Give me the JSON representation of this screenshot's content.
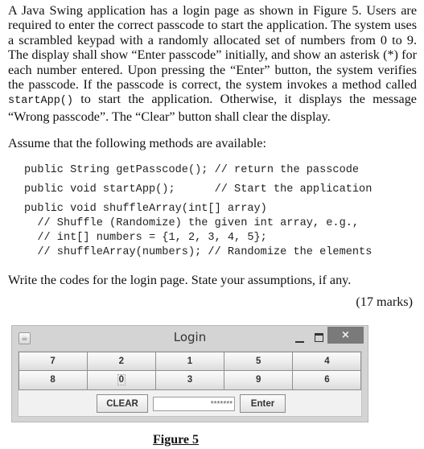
{
  "question": {
    "paragraph_parts": {
      "before_code": "A Java Swing application has a login page as shown in Figure 5.  Users are required to enter the correct passcode to start the application.  The system uses a scrambled keypad with a randomly allocated set of numbers from 0 to 9.  The display shall show “Enter passcode” initially, and show an asterisk (*) for each number entered.  Upon pressing the “Enter” button, the system verifies the passcode.  If the passcode is correct, the system invokes a method called ",
      "inline_code": "startApp()",
      "after_code": " to start the application.  Otherwise, it displays the message “Wrong passcode”.  The “Clear” button shall clear the display."
    },
    "assume_text": "Assume that the following methods are available:",
    "code_lines": [
      "public String getPasscode(); // return the passcode",
      "public void startApp();      // Start the application",
      "public void shuffleArray(int[] array)",
      "  // Shuffle (Randomize) the given int array, e.g.,",
      "  // int[] numbers = {1, 2, 3, 4, 5};",
      "  // shuffleArray(numbers); // Randomize the elements"
    ],
    "instruction": "Write the codes for the login page.  State your assumptions, if any.",
    "marks": "(17 marks)"
  },
  "window": {
    "title": "Login",
    "icon": "java-cup-icon",
    "controls": {
      "minimize": "minimize-icon",
      "maximize": "maximize-icon",
      "close": "×"
    },
    "keypad": [
      [
        "7",
        "2",
        "1",
        "5",
        "4"
      ],
      [
        "8",
        "0",
        "3",
        "9",
        "6"
      ]
    ],
    "focused_key": "0",
    "clear_label": "CLEAR",
    "passcode_display": "*******",
    "enter_label": "Enter"
  },
  "figure_caption": "Figure 5"
}
